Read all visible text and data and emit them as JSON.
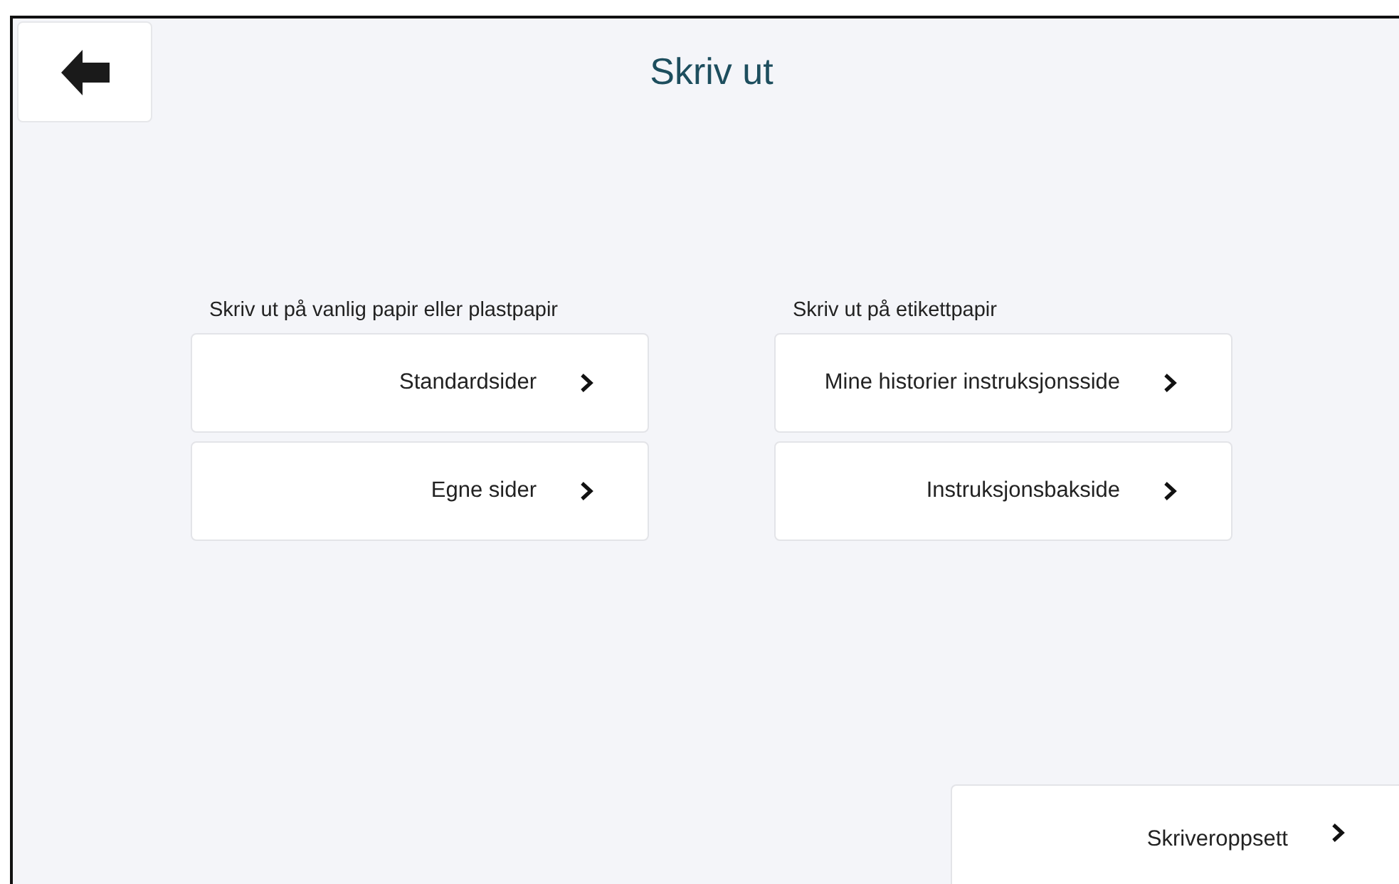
{
  "title": "Skriv ut",
  "sections": [
    {
      "heading": "Skriv ut på vanlig papir eller plastpapir",
      "buttons": [
        {
          "label": "Standardsider"
        },
        {
          "label": "Egne sider"
        }
      ]
    },
    {
      "heading": "Skriv ut på etikettpapir",
      "buttons": [
        {
          "label": "Mine historier instruksjonsside"
        },
        {
          "label": "Instruksjonsbakside"
        }
      ]
    }
  ],
  "footer_button": {
    "label": "Skriveroppsett"
  }
}
